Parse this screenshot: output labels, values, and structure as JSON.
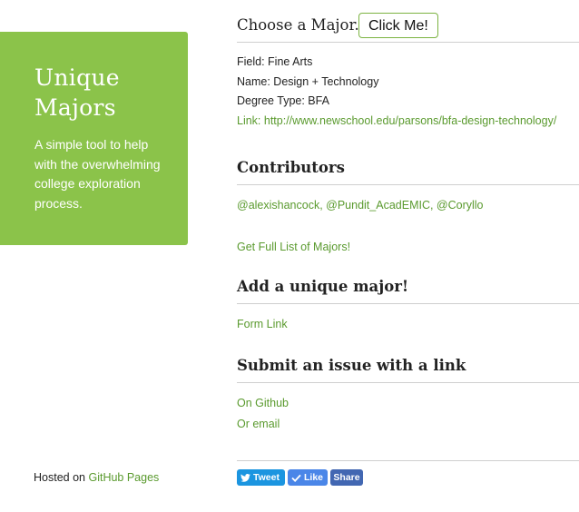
{
  "hero": {
    "title": "Unique Majors",
    "description": "A simple tool to help with the overwhelming college exploration process."
  },
  "footer": {
    "hosted_prefix": "Hosted on ",
    "hosted_link": "GitHub Pages"
  },
  "chooser": {
    "label": "Choose a Major.",
    "button": "Click Me!"
  },
  "major": {
    "field": "Field: Fine Arts",
    "name": "Name: Design + Technology",
    "degree": "Degree Type: BFA",
    "link": "Link: http://www.newschool.edu/parsons/bfa-design-technology/"
  },
  "contributors": {
    "heading": "Contributors",
    "names": "@alexishancock, @Pundit_AcadEMIC, @Coryllo",
    "full_list": "Get Full List of Majors!"
  },
  "add_major": {
    "heading": "Add a unique major!",
    "form_link": "Form Link"
  },
  "issue": {
    "heading": "Submit an issue with a link",
    "github": "On Github",
    "email": "Or email"
  },
  "share": {
    "tweet": "Tweet",
    "like": "Like",
    "share": "Share"
  },
  "colors": {
    "accent": "#8bc34a",
    "link": "#5a9a2e",
    "twitter": "#1b95e0",
    "facebook_like": "#4a86e8",
    "facebook_share": "#4267b2"
  }
}
